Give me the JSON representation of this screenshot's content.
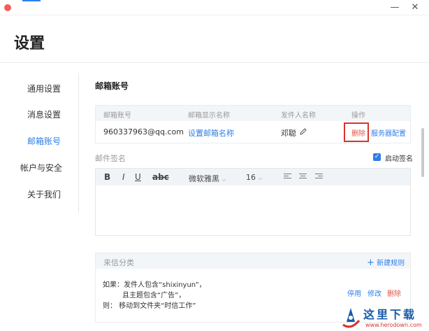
{
  "window": {
    "close_glyph": "✕",
    "minimize_glyph": "—"
  },
  "header": {
    "title": "设置"
  },
  "sidebar": {
    "items": [
      {
        "label": "通用设置"
      },
      {
        "label": "消息设置"
      },
      {
        "label": "邮箱账号",
        "active": true
      },
      {
        "label": "帐户与安全"
      },
      {
        "label": "关于我们"
      }
    ]
  },
  "accounts": {
    "section_title": "邮箱账号",
    "columns": [
      "邮箱账号",
      "邮箱显示名称",
      "发件人名称",
      "操作"
    ],
    "rows": [
      {
        "email": "960337963@qq.com",
        "display_name": "设置邮箱名称",
        "sender_name": "邓聪",
        "actions": [
          "删除",
          "服务器配置"
        ]
      }
    ]
  },
  "signature": {
    "label": "邮件签名",
    "enable_label": "启动签名",
    "enabled": true,
    "toolbar": {
      "bold": "B",
      "italic": "I",
      "underline": "U",
      "strike": "abc",
      "font": "微软雅黑",
      "size": "16"
    }
  },
  "rules": {
    "title": "来信分类",
    "new_rule_label": "新建规则",
    "rule_lines": [
      "如果：发件人包含“shixinyun”，",
      "且主题包含“广告”，",
      "则：   移动到文件夹“时信工作”"
    ],
    "actions": [
      "停用",
      "修改",
      "删除"
    ]
  },
  "watermark": {
    "brand": "这里下载",
    "url": "www.herodown.com"
  },
  "colors": {
    "accent": "#2f7ee8",
    "danger": "#e0554a",
    "highlight_border": "#d9342b",
    "table_header_bg": "#f3f6f9"
  }
}
